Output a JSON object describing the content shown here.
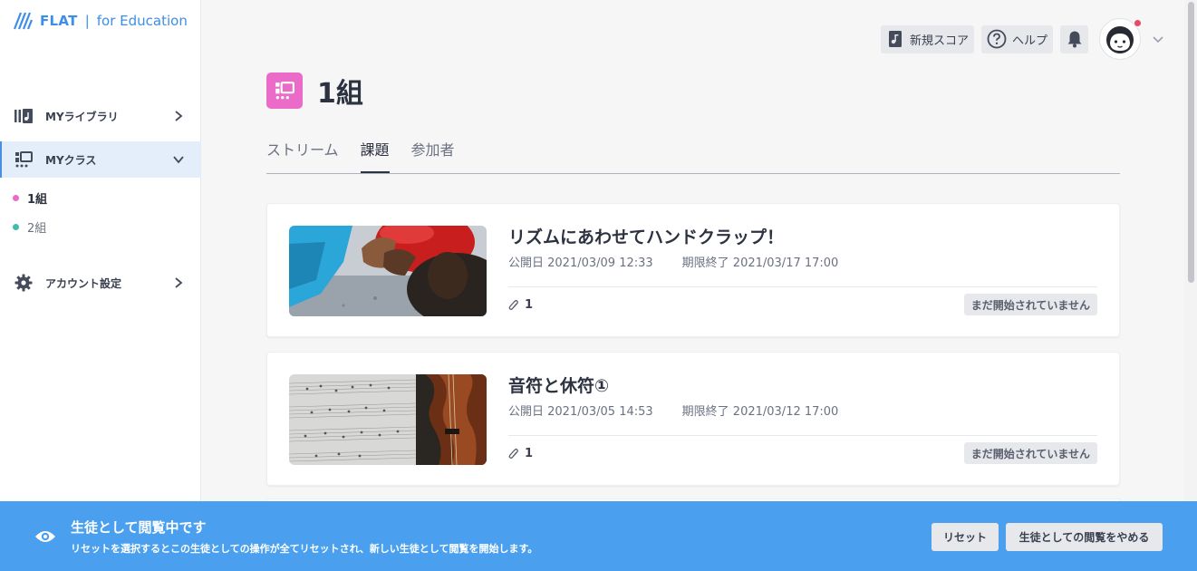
{
  "brand": {
    "name": "FLAT",
    "separator": "|",
    "suffix": "for Education"
  },
  "sidebar": {
    "items": [
      {
        "label": "MYライブラリ",
        "icon": "library-icon"
      },
      {
        "label": "MYクラス",
        "icon": "class-icon"
      },
      {
        "label": "アカウント設定",
        "icon": "gear-icon"
      }
    ],
    "classes": [
      {
        "label": "1組",
        "color": "#ea6bc8"
      },
      {
        "label": "2組",
        "color": "#3fbcae"
      }
    ]
  },
  "topbar": {
    "new_score": "新規スコア",
    "help": "ヘルプ"
  },
  "class": {
    "title": "1組",
    "accent": "#ea6bc8"
  },
  "tabs": [
    {
      "label": "ストリーム"
    },
    {
      "label": "課題"
    },
    {
      "label": "参加者"
    }
  ],
  "assignments": [
    {
      "title": "リズムにあわせてハンドクラップ！",
      "published": "公開日 2021/03/09 12:33",
      "due": "期限終了 2021/03/17 17:00",
      "attachments": "1",
      "status": "まだ開始されていません"
    },
    {
      "title": "音符と休符①",
      "published": "公開日 2021/03/05 14:53",
      "due": "期限終了 2021/03/12 17:00",
      "attachments": "1",
      "status": "まだ開始されていません"
    }
  ],
  "banner": {
    "title": "生徒として閲覧中です",
    "text": "リセットを選択するとこの生徒としての操作が全てリセットされ、新しい生徒として閲覧を開始します。",
    "reset_label": "リセット",
    "stop_label": "生徒としての閲覧をやめる",
    "color": "#4aa0ee"
  }
}
